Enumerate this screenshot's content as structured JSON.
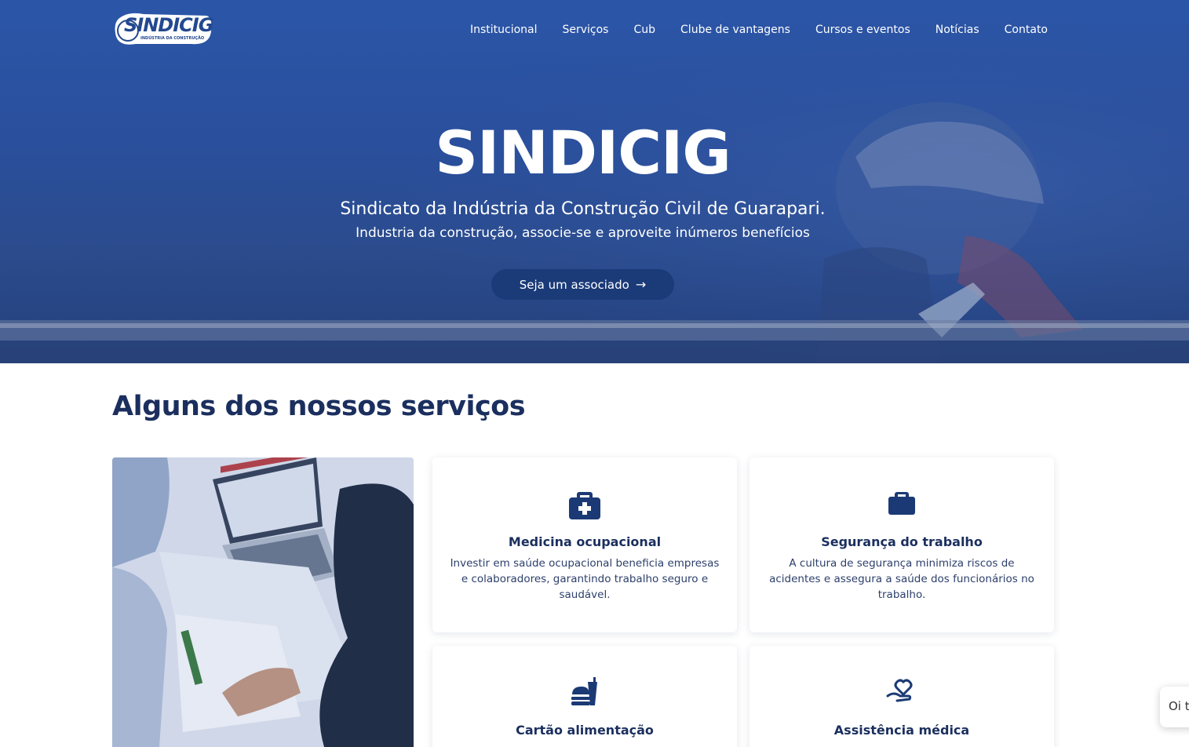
{
  "nav": {
    "logo_text": "SINDICIG",
    "logo_subtext": "INDÚSTRIA DA CONSTRUÇÃO",
    "items": [
      "Institucional",
      "Serviços",
      "Cub",
      "Clube de vantagens",
      "Cursos e eventos",
      "Notícias",
      "Contato"
    ]
  },
  "hero": {
    "title": "SINDICIG",
    "subtitle": "Sindicato da Indústria da Construção Civil de Guarapari.",
    "tagline": "Industria da construção, associe-se e aproveite inúmeros benefícios",
    "cta_label": "Seja um associado",
    "cta_arrow": "→"
  },
  "services": {
    "title": "Alguns dos nossos serviços",
    "cards": [
      {
        "icon": "medical-kit-icon",
        "title": "Medicina ocupacional",
        "desc": "Investir em saúde ocupacional beneficia empresas e colaboradores, garantindo trabalho seguro e saudável."
      },
      {
        "icon": "briefcase-icon",
        "title": "Segurança do trabalho",
        "desc": "A cultura de segurança minimiza riscos de acidentes e assegura a saúde dos funcionários no trabalho."
      },
      {
        "icon": "food-icon",
        "title": "Cartão alimentação",
        "desc": ""
      },
      {
        "icon": "hand-heart-icon",
        "title": "Assistência médica",
        "desc": ""
      }
    ]
  },
  "chat": {
    "text": "Oi tu"
  },
  "colors": {
    "primary": "#1b2f5e",
    "hero_blue": "#2b56a8",
    "cta": "#1a3a78"
  }
}
